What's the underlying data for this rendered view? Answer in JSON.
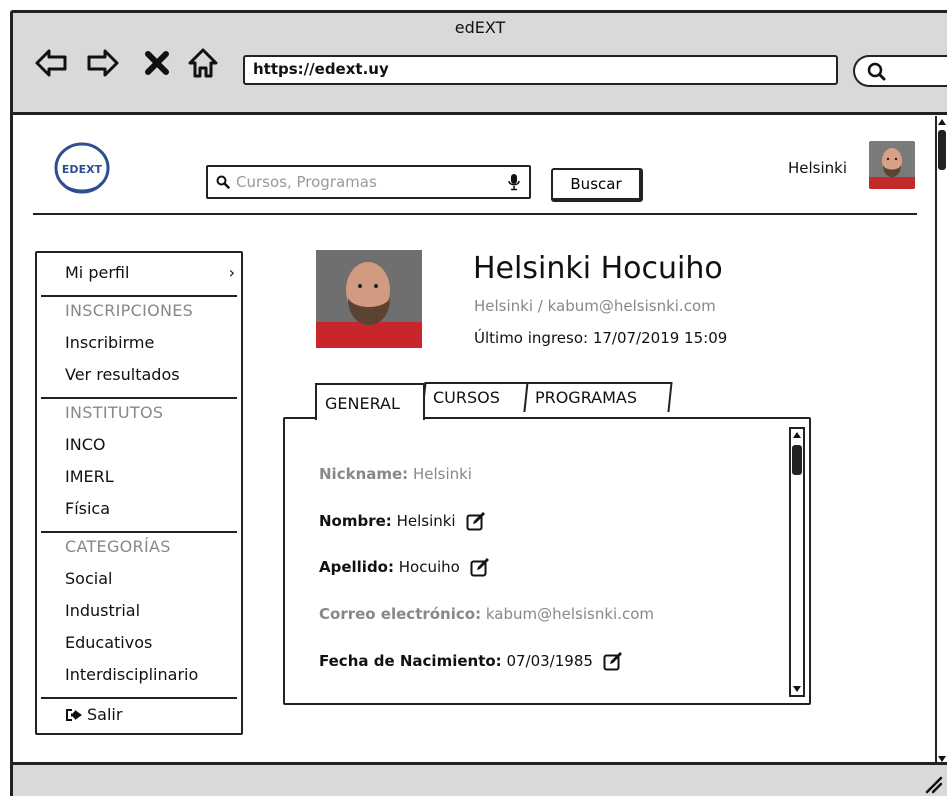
{
  "window": {
    "title": "edEXT",
    "url": "https://edext.uy"
  },
  "icons": {
    "back": "arrow-left-icon",
    "forward": "arrow-right-icon",
    "stop": "close-icon",
    "home": "home-icon",
    "search": "search-icon",
    "mic": "microphone-icon",
    "edit": "edit-icon",
    "logout": "logout-icon",
    "chevron": "chevron-right-icon"
  },
  "header": {
    "logo_text": "EDEXT",
    "search_placeholder": "Cursos, Programas",
    "search_button": "Buscar",
    "username": "Helsinki"
  },
  "sidebar": {
    "profile": "Mi perfil",
    "chevron": "›",
    "sections": [
      {
        "title": "INSCRIPCIONES",
        "items": [
          "Inscribirme",
          "Ver resultados"
        ]
      },
      {
        "title": "INSTITUTOS",
        "items": [
          "INCO",
          "IMERL",
          "Física"
        ]
      },
      {
        "title": "CATEGORÍAS",
        "items": [
          "Social",
          "Industrial",
          "Educativos",
          "Interdisciplinario"
        ]
      }
    ],
    "logout": "Salir"
  },
  "profile": {
    "name": "Helsinki Hocuiho",
    "subtitle": "Helsinki / kabum@helsisnki.com",
    "last_login": "Último ingreso: 17/07/2019 15:09"
  },
  "tabs": [
    {
      "label": "GENERAL",
      "active": true
    },
    {
      "label": "CURSOS",
      "active": false
    },
    {
      "label": "PROGRAMAS",
      "active": false
    }
  ],
  "general": {
    "nickname": {
      "label": "Nickname:",
      "value": "Helsinki",
      "editable": false
    },
    "nombre": {
      "label": "Nombre:",
      "value": "Helsinki",
      "editable": true
    },
    "apellido": {
      "label": "Apellido:",
      "value": "Hocuiho",
      "editable": true
    },
    "correo": {
      "label": "Correo electrónico:",
      "value": "kabum@helsisnki.com",
      "editable": false
    },
    "nacimiento": {
      "label": "Fecha de Nacimiento:",
      "value": "07/03/1985",
      "editable": true
    }
  },
  "colors": {
    "chrome": "#d9d9d9",
    "muted_text": "#888888",
    "ink": "#222222",
    "logo_blue": "#2e4f8f"
  }
}
